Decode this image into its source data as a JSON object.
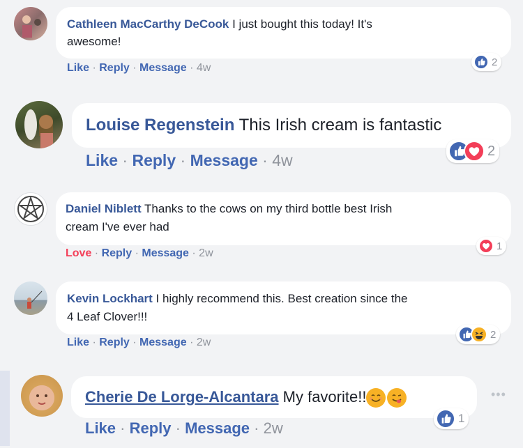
{
  "comments": [
    {
      "name": "Cathleen MacCarthy DeCook",
      "text_line1": " I just bought this today! It's",
      "text_line2": "awesome!",
      "actions": [
        "Like",
        "Reply",
        "Message"
      ],
      "time": "4w",
      "reaction_count": "2",
      "reaction_icons": [
        "like-icon"
      ]
    },
    {
      "name": "Louise Regenstein",
      "text_line1": " This Irish cream is fantastic",
      "actions": [
        "Like",
        "Reply",
        "Message"
      ],
      "time": "4w",
      "reaction_count": "2",
      "reaction_icons": [
        "like-icon",
        "love-icon"
      ]
    },
    {
      "name": "Daniel Niblett",
      "text_line1": " Thanks to the cows on my third bottle best Irish",
      "text_line2": "cream I've ever had",
      "actions": [
        "Love",
        "Reply",
        "Message"
      ],
      "time": "2w",
      "reaction_count": "1",
      "reaction_icons": [
        "love-icon"
      ]
    },
    {
      "name": "Kevin Lockhart",
      "text_line1": " I highly recommend this. Best creation since the",
      "text_line2": "4 Leaf Clover!!!",
      "actions": [
        "Like",
        "Reply",
        "Message"
      ],
      "time": "2w",
      "reaction_count": "2",
      "reaction_icons": [
        "like-icon",
        "haha-icon"
      ]
    },
    {
      "name": "Cherie De Lorge-Alcantara",
      "text_line1": " My favorite!!",
      "actions": [
        "Like",
        "Reply",
        "Message"
      ],
      "time": "2w",
      "reaction_count": "1",
      "reaction_icons": [
        "like-icon"
      ]
    }
  ],
  "separator": " · ",
  "colors": {
    "background": "#f2f3f5",
    "name": "#385898",
    "action": "#4267b2",
    "love": "#f33e58",
    "meta": "#90949c",
    "bubble": "#ffffff"
  }
}
